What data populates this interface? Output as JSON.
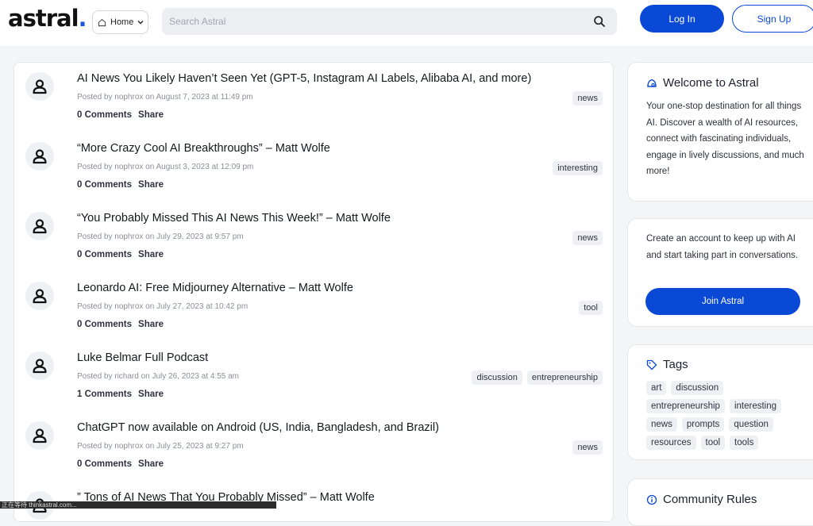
{
  "header": {
    "logo_text": "astral",
    "logo_dot": ".",
    "home_label": "Home",
    "search_placeholder": "Search Astral",
    "login_label": "Log In",
    "signup_label": "Sign Up"
  },
  "posts": [
    {
      "title": "AI News You Likely Haven’t Seen Yet (GPT-5, Instagram AI Labels, Alibaba AI, and more)",
      "meta": "Posted by nophrox on August 7, 2023 at 11:49 pm",
      "comments": "0 Comments",
      "share": "Share",
      "tags": [
        "news"
      ]
    },
    {
      "title": "“More Crazy Cool AI Breakthroughs” – Matt Wolfe",
      "meta": "Posted by nophrox on August 3, 2023 at 12:09 pm",
      "comments": "0 Comments",
      "share": "Share",
      "tags": [
        "interesting"
      ]
    },
    {
      "title": "“You Probably Missed This AI News This Week!” – Matt Wolfe",
      "meta": "Posted by nophrox on July 29, 2023 at 9:57 pm",
      "comments": "0 Comments",
      "share": "Share",
      "tags": [
        "news"
      ]
    },
    {
      "title": "Leonardo AI: Free Midjourney Alternative – Matt Wolfe",
      "meta": "Posted by nophrox on July 27, 2023 at 10:42 pm",
      "comments": "0 Comments",
      "share": "Share",
      "tags": [
        "tool"
      ]
    },
    {
      "title": "Luke Belmar Full Podcast",
      "meta": "Posted by richard on July 26, 2023 at 4:55 am",
      "comments": "1 Comments",
      "share": "Share",
      "tags": [
        "discussion",
        "entrepreneurship"
      ]
    },
    {
      "title": "ChatGPT now available on Android (US, India, Bangladesh, and Brazil)",
      "meta": "Posted by nophrox on July 25, 2023 at 9:27 pm",
      "comments": "0 Comments",
      "share": "Share",
      "tags": [
        "news"
      ]
    },
    {
      "title": "” Tons of AI News That You Probably Missed” – Matt Wolfe",
      "meta": "",
      "comments": "",
      "share": "",
      "tags": []
    }
  ],
  "sidebar": {
    "welcome_title": "Welcome to Astral",
    "welcome_text": "Your one-stop destination for all things AI. Discover a wealth of AI resources, connect with fascinating individuals, engage in lively discussions, and much more!",
    "create_text": "Create an account to keep up with AI and start taking part in conversations.",
    "join_label": "Join Astral",
    "tags_title": "Tags",
    "tags": [
      "art",
      "discussion",
      "entrepreneurship",
      "interesting",
      "news",
      "prompts",
      "question",
      "resources",
      "tool",
      "tools"
    ],
    "rules_title": "Community Rules"
  },
  "status_bar": {
    "url": "正在等待 thinkastral.com..."
  },
  "colors": {
    "accent": "#0a49d6",
    "tag_bg": "#eef0f3",
    "page_bg": "#f4f5f7"
  },
  "icons": [
    "home-icon",
    "chevron-down-icon",
    "search-icon",
    "user-icon",
    "astral-logo-icon",
    "tag-icon",
    "info-icon"
  ]
}
